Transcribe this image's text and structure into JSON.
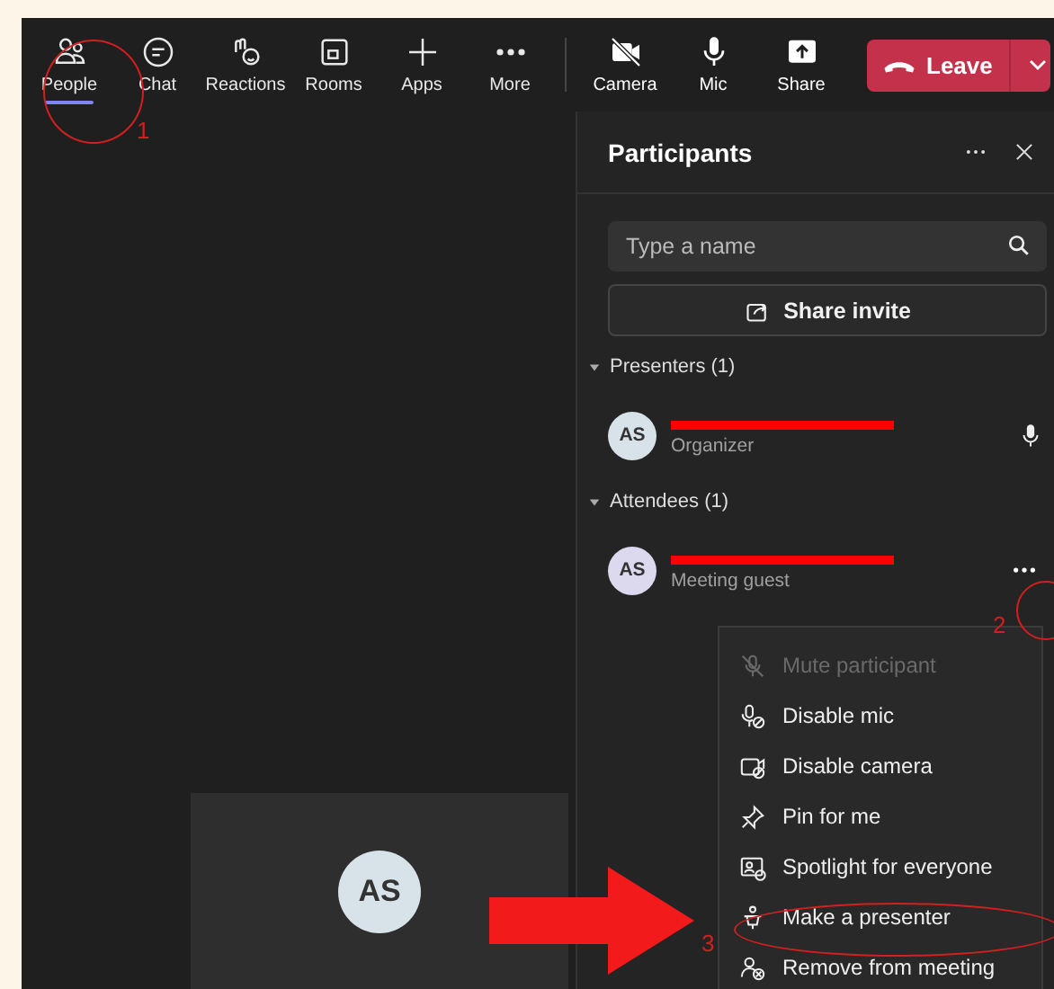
{
  "toolbar": {
    "items": [
      {
        "label": "People",
        "selected": true
      },
      {
        "label": "Chat",
        "selected": false
      },
      {
        "label": "Reactions",
        "selected": false
      },
      {
        "label": "Rooms",
        "selected": false
      },
      {
        "label": "Apps",
        "selected": false
      },
      {
        "label": "More",
        "selected": false
      }
    ],
    "actions": [
      {
        "label": "Camera"
      },
      {
        "label": "Mic"
      },
      {
        "label": "Share"
      }
    ],
    "leave": {
      "label": "Leave"
    }
  },
  "stage": {
    "tile": {
      "initials": "AS"
    }
  },
  "panel": {
    "title": "Participants",
    "search": {
      "placeholder": "Type a name"
    },
    "share_button": "Share invite",
    "sections": [
      {
        "title": "Presenters (1)",
        "expanded": true,
        "participants": [
          {
            "initials": "AS",
            "role": "Organizer",
            "color": "#d7e3e8"
          }
        ]
      },
      {
        "title": "Attendees (1)",
        "expanded": true,
        "participants": [
          {
            "initials": "AS",
            "role": "Meeting guest",
            "color": "#dcd8ee"
          }
        ]
      }
    ]
  },
  "context_menu": {
    "items": [
      {
        "label": "Mute participant",
        "disabled": true
      },
      {
        "label": "Disable mic",
        "disabled": false
      },
      {
        "label": "Disable camera",
        "disabled": false
      },
      {
        "label": "Pin for me",
        "disabled": false
      },
      {
        "label": "Spotlight for everyone",
        "disabled": false
      },
      {
        "label": "Make a presenter",
        "disabled": false
      },
      {
        "label": "Remove from meeting",
        "disabled": false
      }
    ]
  },
  "annotations": [
    {
      "label": "1"
    },
    {
      "label": "2"
    },
    {
      "label": "3"
    }
  ]
}
